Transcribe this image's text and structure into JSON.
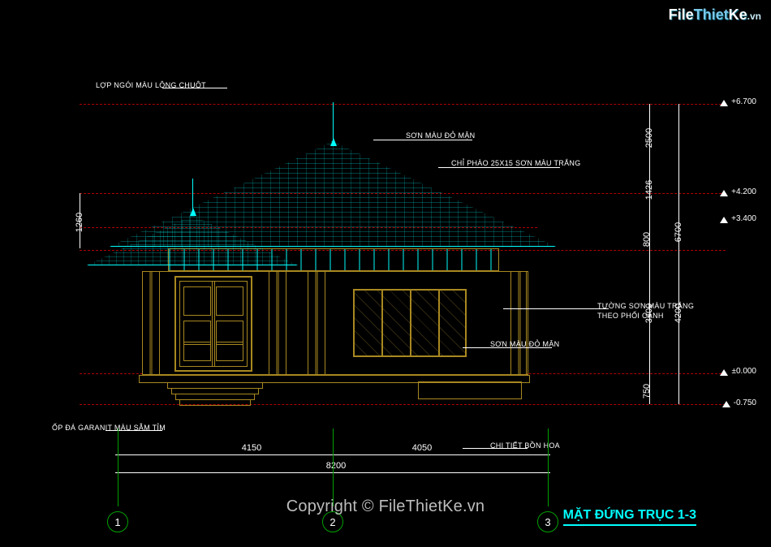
{
  "watermark": {
    "part1": "File",
    "part2": "Thiet",
    "part3": "Ke",
    "suffix": ".vn"
  },
  "copyright": "Copyright © FileThietKe.vn",
  "title": "MẶT ĐỨNG TRỤC 1-3",
  "labels": {
    "roof_tile": "LỢP NGÓI MÀU LÔNG CHUỘT",
    "paint_plum": "SƠN MÀU ĐỎ MẬN",
    "molding": "CHỈ PHÀO 25X15 SƠN MÀU TRẮNG",
    "wall_white_1": "TƯỜNG SƠN MÀU TRẮNG",
    "wall_white_2": "THEO PHỐI CẢNH",
    "paint_plum_2": "SƠN MÀU ĐỎ MẬN",
    "granite": "ỐP ĐÁ GARANIT MÀU SẪM TỈM",
    "planter_detail": "CHI TIẾT BỒN HOA"
  },
  "dims_h": {
    "span1": "4150",
    "span2": "4050",
    "total": "8200"
  },
  "dims_v": {
    "d1": "750",
    "d2": "3400",
    "d3": "800",
    "d4": "1426",
    "d5": "2500",
    "sub_total": "4200",
    "overall": "6700",
    "porch": "1260"
  },
  "elevations": {
    "e0": "±0.000",
    "em075": "-0.750",
    "ep34": "+3.400",
    "ep42": "+4.200",
    "ep67": "+6.700"
  },
  "axes": {
    "a1": "1",
    "a2": "2",
    "a3": "3"
  }
}
